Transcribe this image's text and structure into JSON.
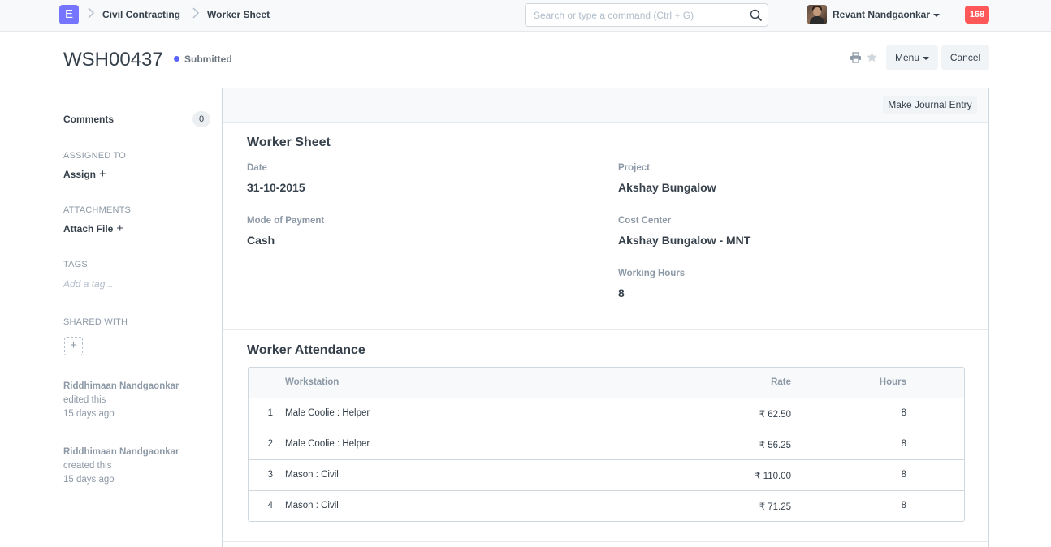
{
  "navbar": {
    "logo_letter": "E",
    "breadcrumbs": [
      "Civil Contracting",
      "Worker Sheet"
    ],
    "search_placeholder": "Search or type a command (Ctrl + G)",
    "user_name": "Revant Nandgaonkar",
    "notification_count": "168"
  },
  "page": {
    "title": "WSH00437",
    "status": "Submitted",
    "menu_label": "Menu",
    "cancel_label": "Cancel"
  },
  "sidebar": {
    "comments_label": "Comments",
    "comments_count": "0",
    "assigned_to_label": "Assigned To",
    "assign_label": "Assign",
    "attachments_label": "Attachments",
    "attach_label": "Attach File",
    "tags_label": "Tags",
    "tag_placeholder": "Add a tag...",
    "shared_with_label": "Shared With",
    "timeline": [
      {
        "who": "Riddhimaan Nandgaonkar",
        "action": "edited this",
        "when": "15 days ago"
      },
      {
        "who": "Riddhimaan Nandgaonkar",
        "action": "created this",
        "when": "15 days ago"
      }
    ]
  },
  "form": {
    "make_journal_entry_label": "Make Journal Entry",
    "section1_title": "Worker Sheet",
    "fields": {
      "date_label": "Date",
      "date_value": "31-10-2015",
      "mode_label": "Mode of Payment",
      "mode_value": "Cash",
      "project_label": "Project",
      "project_value": "Akshay Bungalow",
      "cost_center_label": "Cost Center",
      "cost_center_value": "Akshay Bungalow - MNT",
      "hours_label": "Working Hours",
      "hours_value": "8"
    },
    "section2_title": "Worker Attendance",
    "table": {
      "headers": {
        "workstation": "Workstation",
        "rate": "Rate",
        "hours": "Hours"
      },
      "rows": [
        {
          "idx": "1",
          "workstation": "Male Coolie : Helper",
          "rate": "₹ 62.50",
          "hours": "8"
        },
        {
          "idx": "2",
          "workstation": "Male Coolie : Helper",
          "rate": "₹ 56.25",
          "hours": "8"
        },
        {
          "idx": "3",
          "workstation": "Mason : Civil",
          "rate": "₹ 110.00",
          "hours": "8"
        },
        {
          "idx": "4",
          "workstation": "Mason : Civil",
          "rate": "₹ 71.25",
          "hours": "8"
        }
      ]
    }
  }
}
